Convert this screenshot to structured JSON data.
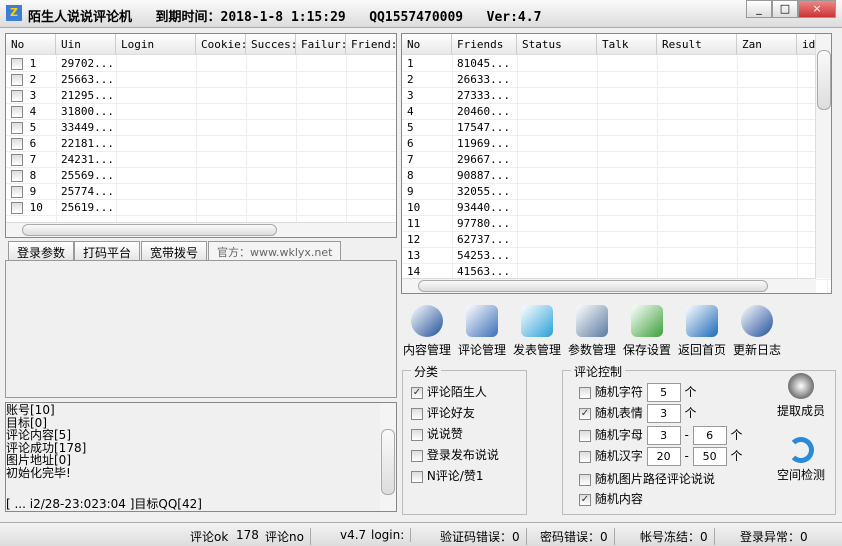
{
  "title": {
    "app": "陌生人说说评论机",
    "expire": "到期时间：2018-1-8 1:15:29",
    "qq": "QQ1557470009",
    "ver": "Ver:4.7"
  },
  "window_buttons": [
    "_",
    "□",
    "×"
  ],
  "accounts": {
    "columns": [
      "No",
      "Uin",
      "Login",
      "Cookie:",
      "Succes:",
      "Failur:",
      "Friend:"
    ],
    "rows": [
      [
        "1",
        "29702..."
      ],
      [
        "2",
        "25663..."
      ],
      [
        "3",
        "21295..."
      ],
      [
        "4",
        "31800..."
      ],
      [
        "5",
        "33449..."
      ],
      [
        "6",
        "22181..."
      ],
      [
        "7",
        "24231..."
      ],
      [
        "8",
        "25569..."
      ],
      [
        "9",
        "25774..."
      ],
      [
        "10",
        "25619..."
      ]
    ]
  },
  "friends": {
    "columns": [
      "No",
      "Friends",
      "Status",
      "Talk",
      "Result",
      "Zan",
      "id"
    ],
    "rows": [
      [
        "1",
        "81045..."
      ],
      [
        "2",
        "26633..."
      ],
      [
        "3",
        "27333..."
      ],
      [
        "4",
        "20460..."
      ],
      [
        "5",
        "17547..."
      ],
      [
        "6",
        "11969..."
      ],
      [
        "7",
        "29667..."
      ],
      [
        "8",
        "90887..."
      ],
      [
        "9",
        "32055..."
      ],
      [
        "10",
        "93440..."
      ],
      [
        "11",
        "97780..."
      ],
      [
        "12",
        "62737..."
      ],
      [
        "13",
        "54253..."
      ],
      [
        "14",
        "41563..."
      ]
    ]
  },
  "tabs": [
    "登录参数",
    "打码平台",
    "宽带拨号",
    "官方：www.wklyx.net"
  ],
  "log": [
    "账号[10]",
    "目标[0]",
    "评论内容[5]",
    "评论成功[178]",
    "图片地址[0]",
    "初始化完毕!",
    "",
    "[ ... i2/28-23:023:04 ]目标QQ[42]"
  ],
  "toolbar": [
    {
      "label": "内容管理",
      "icon": "pen-icon",
      "color": "#1f4f9a"
    },
    {
      "label": "评论管理",
      "icon": "computer-icon",
      "color": "#3a6fb8"
    },
    {
      "label": "发表管理",
      "icon": "chat-icon",
      "color": "#2aa0d8"
    },
    {
      "label": "参数管理",
      "icon": "gear-icon",
      "color": "#5a7aa0"
    },
    {
      "label": "保存设置",
      "icon": "save-icon",
      "color": "#3aa03a"
    },
    {
      "label": "返回首页",
      "icon": "window-icon",
      "color": "#1a6ab8"
    },
    {
      "label": "更新日志",
      "icon": "home-icon",
      "color": "#1f4f9a"
    }
  ],
  "category": {
    "label": "分类",
    "options": [
      {
        "label": "评论陌生人",
        "checked": true
      },
      {
        "label": "评论好友",
        "checked": false
      },
      {
        "label": "说说赞",
        "checked": false
      },
      {
        "label": "登录发布说说",
        "checked": false
      },
      {
        "label": "N评论/赞1",
        "checked": false
      }
    ]
  },
  "control": {
    "label": "评论控制",
    "random_chars": {
      "label": "随机字符",
      "checked": false,
      "value": "5",
      "unit": "个"
    },
    "random_emoji": {
      "label": "随机表情",
      "checked": true,
      "value": "3",
      "unit": "个"
    },
    "random_letters": {
      "label": "随机字母",
      "checked": false,
      "min": "3",
      "max": "6",
      "sep": "-",
      "unit": "个"
    },
    "random_hanzi": {
      "label": "随机汉字",
      "checked": false,
      "min": "20",
      "max": "50",
      "sep": "-",
      "unit": "个"
    },
    "random_image": {
      "label": "随机图片路径评论说说",
      "checked": false
    },
    "random_content": {
      "label": "随机内容",
      "checked": true
    },
    "extract": "提取成员",
    "check": "空间检测"
  },
  "status": {
    "ok_label": "评论ok",
    "ok_count": "178",
    "no_label": "评论no",
    "version": "v4.7",
    "login": "login:",
    "captcha_err": "验证码错误：0",
    "pwd_err": "密码错误：0",
    "frozen": "帐号冻结：0",
    "login_err": "登录异常：0"
  }
}
